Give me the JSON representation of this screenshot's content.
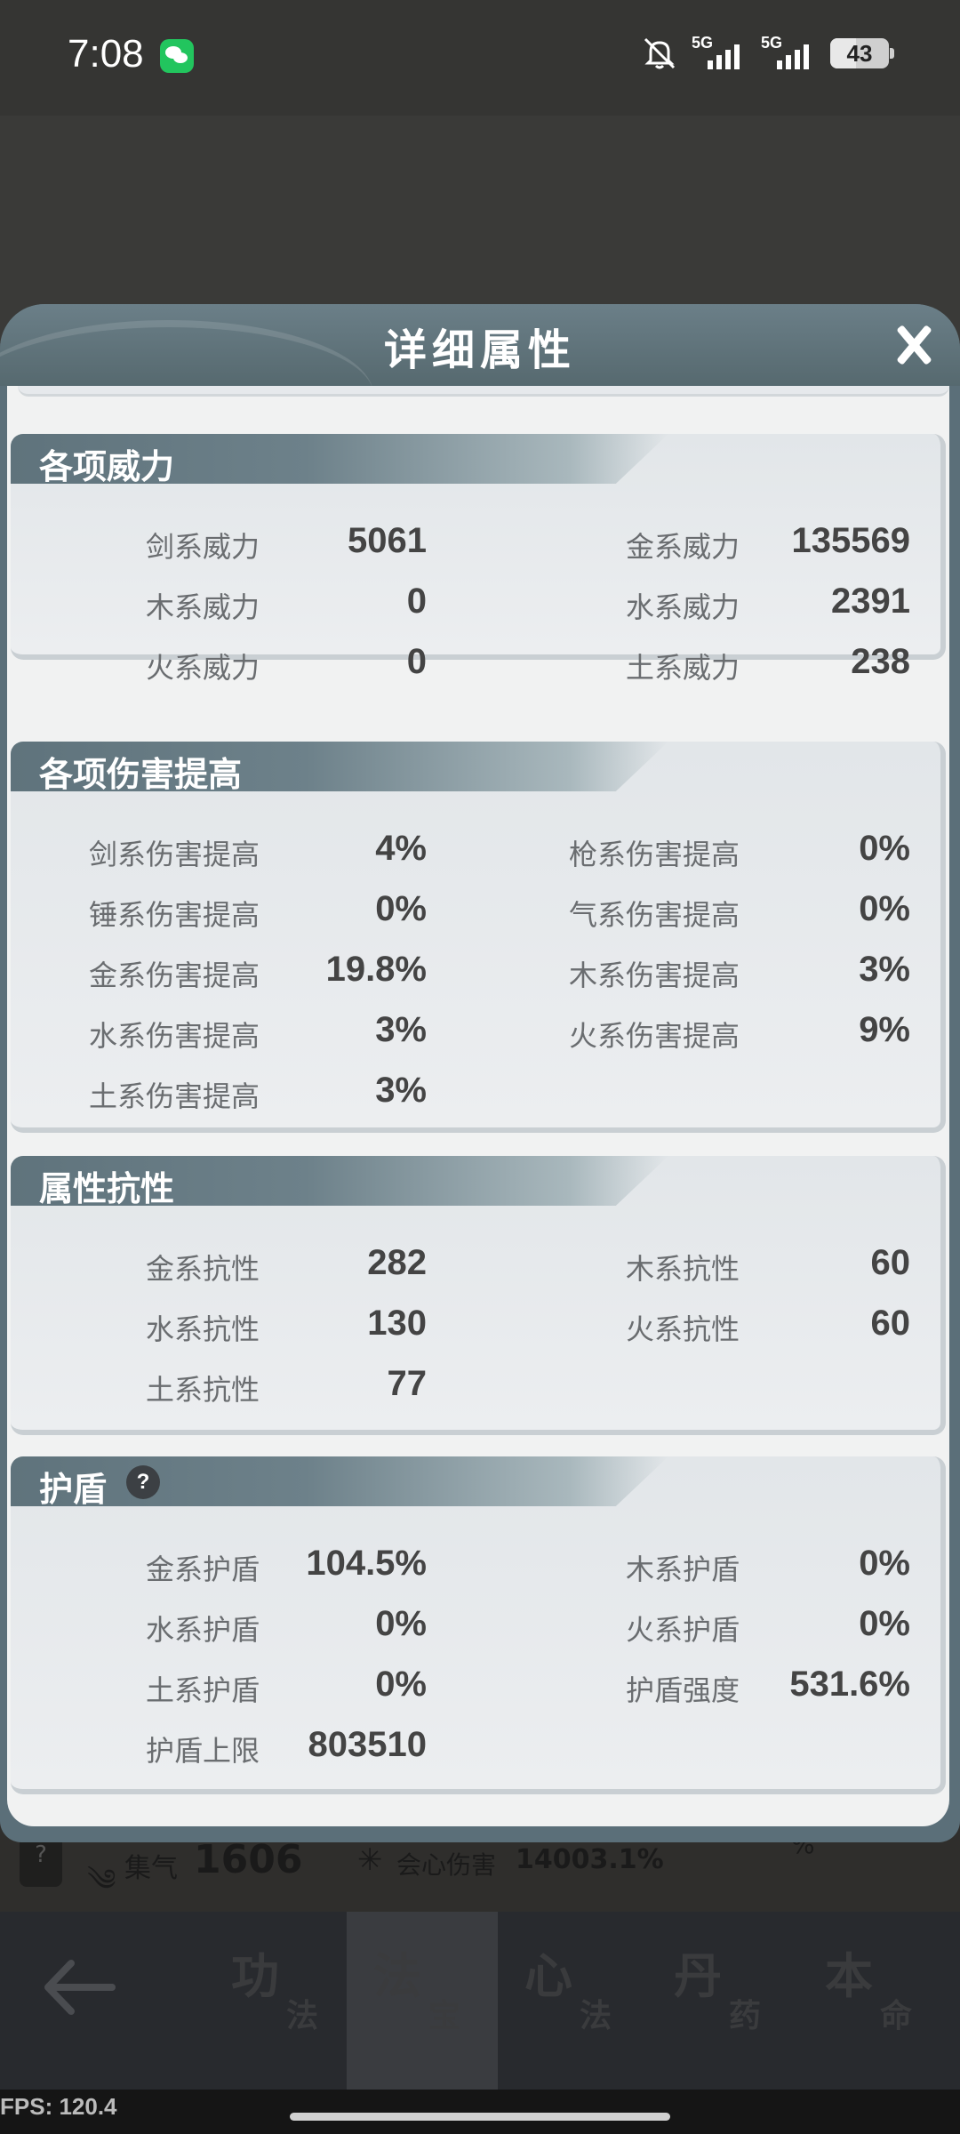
{
  "status_bar": {
    "time": "7:08",
    "signal1": "5G",
    "signal2": "5G",
    "battery": "43",
    "icons": [
      "wechat-icon",
      "mute-icon",
      "signal-icon",
      "battery-icon"
    ]
  },
  "dialog": {
    "title": "详细属性",
    "sections": {
      "power": {
        "title": "各项威力",
        "left": [
          {
            "label": "剑系威力",
            "value": "5061"
          },
          {
            "label": "木系威力",
            "value": "0"
          },
          {
            "label": "火系威力",
            "value": "0"
          }
        ],
        "right": [
          {
            "label": "金系威力",
            "value": "135569"
          },
          {
            "label": "水系威力",
            "value": "2391"
          },
          {
            "label": "土系威力",
            "value": "238"
          }
        ]
      },
      "damage": {
        "title": "各项伤害提高",
        "left": [
          {
            "label": "剑系伤害提高",
            "value": "4%"
          },
          {
            "label": "锤系伤害提高",
            "value": "0%"
          },
          {
            "label": "金系伤害提高",
            "value": "19.8%"
          },
          {
            "label": "水系伤害提高",
            "value": "3%"
          },
          {
            "label": "土系伤害提高",
            "value": "3%"
          }
        ],
        "right": [
          {
            "label": "枪系伤害提高",
            "value": "0%"
          },
          {
            "label": "气系伤害提高",
            "value": "0%"
          },
          {
            "label": "木系伤害提高",
            "value": "3%"
          },
          {
            "label": "火系伤害提高",
            "value": "9%"
          }
        ]
      },
      "resist": {
        "title": "属性抗性",
        "left": [
          {
            "label": "金系抗性",
            "value": "282"
          },
          {
            "label": "水系抗性",
            "value": "130"
          },
          {
            "label": "土系抗性",
            "value": "77"
          }
        ],
        "right": [
          {
            "label": "木系抗性",
            "value": "60"
          },
          {
            "label": "火系抗性",
            "value": "60"
          }
        ]
      },
      "shield": {
        "title": "护盾",
        "help": "?",
        "left": [
          {
            "label": "金系护盾",
            "value": "104.5%"
          },
          {
            "label": "水系护盾",
            "value": "0%"
          },
          {
            "label": "土系护盾",
            "value": "0%"
          },
          {
            "label": "护盾上限",
            "value": "803510"
          }
        ],
        "right": [
          {
            "label": "木系护盾",
            "value": "0%"
          },
          {
            "label": "火系护盾",
            "value": "0%"
          },
          {
            "label": "护盾强度",
            "value": "531.6%"
          }
        ]
      }
    }
  },
  "background": {
    "qi_label": "集气",
    "qi_value": "1606",
    "crit_label": "会心伤害",
    "crit_value": "14003.1%",
    "right_partial": "%"
  },
  "bottom_nav": {
    "tabs": [
      {
        "big": "功",
        "small": "法"
      },
      {
        "big": "法",
        "small": "宝"
      },
      {
        "big": "心",
        "small": "法"
      },
      {
        "big": "丹",
        "small": "药"
      },
      {
        "big": "本",
        "small": "命"
      }
    ],
    "active_index": 1
  },
  "fps": "FPS: 120.4"
}
